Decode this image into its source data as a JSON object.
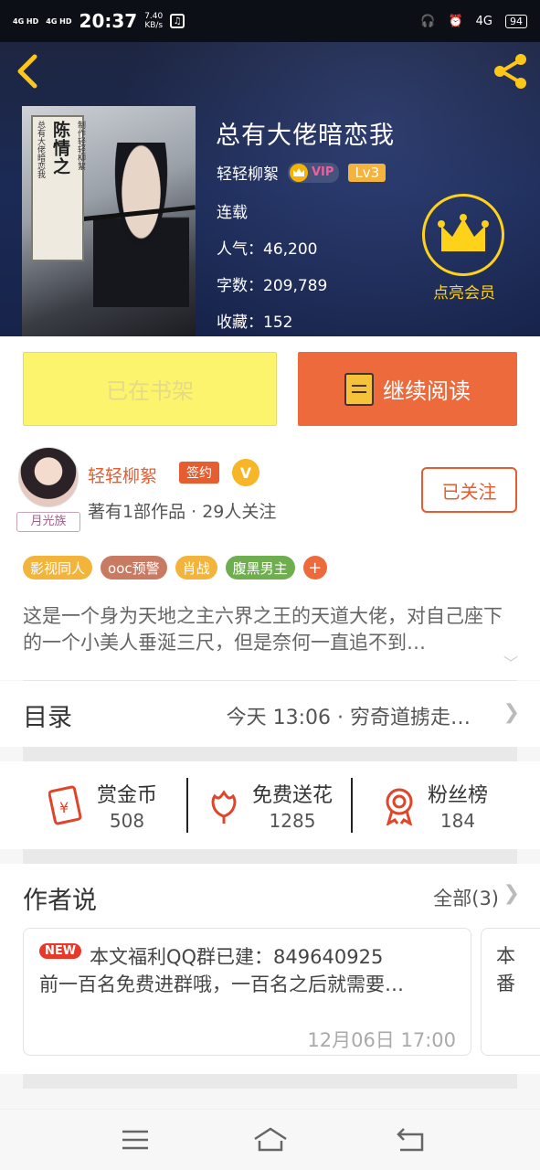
{
  "status_bar": {
    "network1": "4G HD",
    "network2": "4G HD",
    "time": "20:37",
    "speed_value": "7.40",
    "speed_unit": "KB/s",
    "network3": "4G",
    "battery": "94"
  },
  "book": {
    "title": "总有大佬暗恋我",
    "author": "轻轻柳絮",
    "vip_label": "VIP",
    "level": "Lv3",
    "status": "连载",
    "popularity_label": "人气：",
    "popularity": "46,200",
    "wordcount_label": "字数：",
    "wordcount": "209,789",
    "favorites_label": "收藏：",
    "favorites": "152",
    "cover_title_big": "陈情之",
    "cover_title_small1": "制作轻轻柳絮",
    "cover_title_small2": "总有大佬暗恋我"
  },
  "vip_member": {
    "label": "点亮会员"
  },
  "actions": {
    "shelf_label": "已在书架",
    "read_label": "继续阅读"
  },
  "author_info": {
    "name": "轻轻柳絮",
    "sign_badge": "签约",
    "v_badge": "V",
    "avatar_tag": "月光族",
    "works": "著有1部作品 · 29人关注",
    "follow_label": "已关注"
  },
  "tags": [
    {
      "label": "影视同人",
      "color": "#f2b43b"
    },
    {
      "label": "ooc预警",
      "color": "#c97a62"
    },
    {
      "label": "肖战",
      "color": "#f2b43b"
    },
    {
      "label": "腹黑男主",
      "color": "#6eae4e"
    },
    {
      "label": "+",
      "color": "#ec6a3b"
    }
  ],
  "intro": {
    "text": "这是一个身为天地之主六界之王的天道大佬，对自己座下的一个小美人垂涎三尺，但是奈何一直追不到…"
  },
  "toc": {
    "title": "目录",
    "latest": "今天 13:06 · 穷奇道掳走…"
  },
  "gifts": [
    {
      "label": "赏金币",
      "count": "508"
    },
    {
      "label": "免费送花",
      "count": "1285"
    },
    {
      "label": "粉丝榜",
      "count": "184"
    }
  ],
  "author_say": {
    "title": "作者说",
    "all_label": "全部(3)",
    "new_badge": "NEW",
    "note_line1": "本文福利QQ群已建：849640925",
    "note_line2": "前一百名免费进群哦，一百名之后就需要…",
    "note_date": "12月06日  17:00",
    "peek_line1": "本",
    "peek_line2": "番"
  },
  "colors": {
    "accent": "#ec6a3b",
    "shelf_yellow": "#fbf46c",
    "vip_gold": "#ffd21a"
  }
}
